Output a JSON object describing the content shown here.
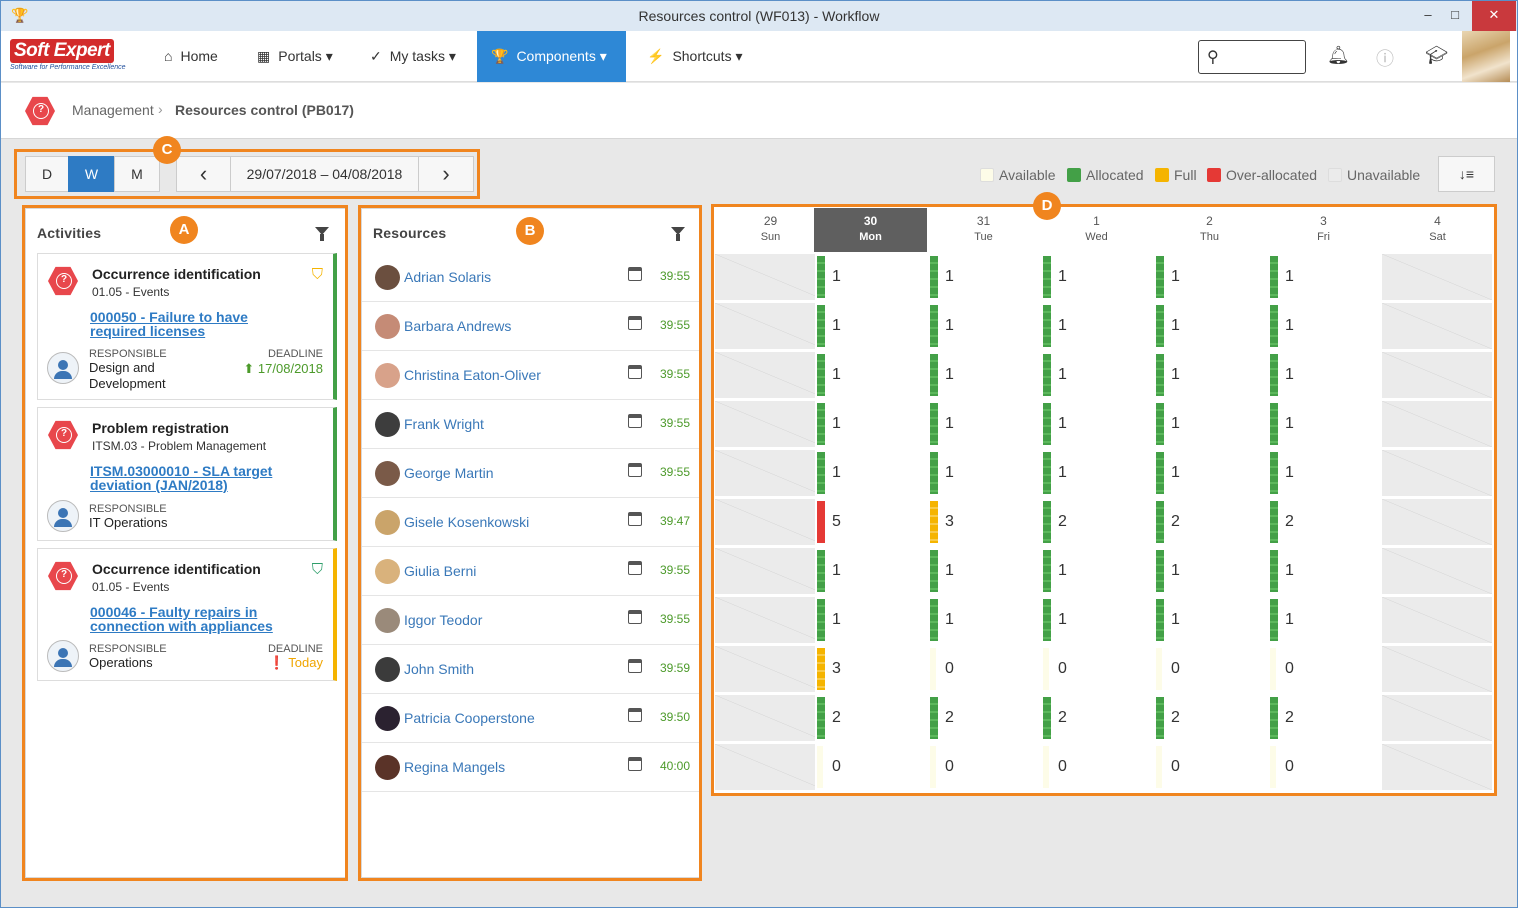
{
  "window": {
    "title": "Resources control (WF013) - Workflow",
    "controls": {
      "minimize": "–",
      "maximize": "□",
      "close": "✕"
    }
  },
  "nav": {
    "logo": {
      "text": "Soft Expert",
      "tagline": "Software for Performance Excellence"
    },
    "items": [
      {
        "label": "Home",
        "icon": "home-icon",
        "glyph": "⌂"
      },
      {
        "label": "Portals",
        "icon": "grid-icon",
        "glyph": "▦"
      },
      {
        "label": "My tasks",
        "icon": "check-icon",
        "glyph": "✓"
      },
      {
        "label": "Components",
        "icon": "trophy-icon",
        "glyph": "🏆"
      },
      {
        "label": "Shortcuts",
        "icon": "bolt-icon",
        "glyph": "⚡"
      }
    ],
    "dropdown_caret": "▾",
    "active_item": "Components",
    "search_placeholder": "",
    "icons": [
      "search-icon",
      "bell-icon",
      "help-icon",
      "graduation-cap-icon"
    ]
  },
  "breadcrumb": {
    "parent": "Management",
    "separator": "›",
    "current": "Resources control (PB017)"
  },
  "toolbar": {
    "views": [
      "D",
      "W",
      "M"
    ],
    "active_view": "W",
    "prev": "‹",
    "next": "›",
    "range": "29/07/2018 – 04/08/2018"
  },
  "legend": [
    {
      "label": "Available",
      "color": "#fdfce8"
    },
    {
      "label": "Allocated",
      "color": "#43a047"
    },
    {
      "label": "Full",
      "color": "#f5b400"
    },
    {
      "label": "Over-allocated",
      "color": "#e53935"
    },
    {
      "label": "Unavailable",
      "color": "#ebebeb"
    }
  ],
  "sort_button": "↓≡",
  "annotations": {
    "a": "A",
    "b": "B",
    "c": "C",
    "d": "D"
  },
  "activities": {
    "header": "Activities",
    "cards": [
      {
        "title": "Occurrence identification",
        "subtitle": "01.05 - Events",
        "link_lines": [
          "000050 - Failure to have",
          "required licenses"
        ],
        "responsible_label": "RESPONSIBLE",
        "responsible_lines": [
          "Design and",
          "Development"
        ],
        "deadline_label": "DEADLINE",
        "deadline": "17/08/2018",
        "deadline_glyph": "⬆",
        "deadline_color": "#4c9a2a",
        "shield_glyph": "⛉",
        "shield_color": "#f5b400",
        "accent": "#43a047"
      },
      {
        "title": "Problem registration",
        "subtitle": "ITSM.03 - Problem Management",
        "link_lines": [
          "ITSM.03000010 - SLA target",
          "deviation (JAN/2018)"
        ],
        "responsible_label": "RESPONSIBLE",
        "responsible_lines": [
          "IT Operations"
        ],
        "accent": "#43a047"
      },
      {
        "title": "Occurrence identification",
        "subtitle": "01.05 - Events",
        "link_lines": [
          "000046 - Faulty repairs in",
          "connection with appliances"
        ],
        "responsible_label": "RESPONSIBLE",
        "responsible_lines": [
          "Operations"
        ],
        "deadline_label": "DEADLINE",
        "deadline": "Today",
        "deadline_glyph": "❗",
        "deadline_color": "#f0a500",
        "shield_glyph": "⛉",
        "shield_color": "#2e9e6a",
        "accent": "#f5b400"
      }
    ]
  },
  "resources": {
    "header": "Resources",
    "rows": [
      {
        "name": "Adrian Solaris",
        "hours": "39:55",
        "avatar": "#6b4f3f"
      },
      {
        "name": "Barbara Andrews",
        "hours": "39:55",
        "avatar": "#c58b76"
      },
      {
        "name": "Christina Eaton-Oliver",
        "hours": "39:55",
        "avatar": "#d8a28a"
      },
      {
        "name": "Frank Wright",
        "hours": "39:55",
        "avatar": "#3d3d3d"
      },
      {
        "name": "George Martin",
        "hours": "39:55",
        "avatar": "#7a5a48"
      },
      {
        "name": "Gisele Kosenkowski",
        "hours": "39:47",
        "avatar": "#caa46a"
      },
      {
        "name": "Giulia Berni",
        "hours": "39:55",
        "avatar": "#d9b27c"
      },
      {
        "name": "Iggor Teodor",
        "hours": "39:55",
        "avatar": "#9a8a7a"
      },
      {
        "name": "John Smith",
        "hours": "39:59",
        "avatar": "#3b3b3b"
      },
      {
        "name": "Patricia Cooperstone",
        "hours": "39:50",
        "avatar": "#2b2230"
      },
      {
        "name": "Regina Mangels",
        "hours": "40:00",
        "avatar": "#5a3328"
      }
    ]
  },
  "calendar": {
    "days": [
      {
        "num": "29",
        "dow": "Sun"
      },
      {
        "num": "30",
        "dow": "Mon",
        "selected": true
      },
      {
        "num": "31",
        "dow": "Tue"
      },
      {
        "num": "1",
        "dow": "Wed"
      },
      {
        "num": "2",
        "dow": "Thu"
      },
      {
        "num": "3",
        "dow": "Fri"
      },
      {
        "num": "4",
        "dow": "Sat"
      }
    ],
    "rows": [
      [
        null,
        [
          "1",
          "alloc"
        ],
        [
          "1",
          "alloc"
        ],
        [
          "1",
          "alloc"
        ],
        [
          "1",
          "alloc"
        ],
        [
          "1",
          "alloc"
        ],
        null
      ],
      [
        null,
        [
          "1",
          "alloc"
        ],
        [
          "1",
          "alloc"
        ],
        [
          "1",
          "alloc"
        ],
        [
          "1",
          "alloc"
        ],
        [
          "1",
          "alloc"
        ],
        null
      ],
      [
        null,
        [
          "1",
          "alloc"
        ],
        [
          "1",
          "alloc"
        ],
        [
          "1",
          "alloc"
        ],
        [
          "1",
          "alloc"
        ],
        [
          "1",
          "alloc"
        ],
        null
      ],
      [
        null,
        [
          "1",
          "alloc"
        ],
        [
          "1",
          "alloc"
        ],
        [
          "1",
          "alloc"
        ],
        [
          "1",
          "alloc"
        ],
        [
          "1",
          "alloc"
        ],
        null
      ],
      [
        null,
        [
          "1",
          "alloc"
        ],
        [
          "1",
          "alloc"
        ],
        [
          "1",
          "alloc"
        ],
        [
          "1",
          "alloc"
        ],
        [
          "1",
          "alloc"
        ],
        null
      ],
      [
        null,
        [
          "5",
          "over"
        ],
        [
          "3",
          "full"
        ],
        [
          "2",
          "alloc"
        ],
        [
          "2",
          "alloc"
        ],
        [
          "2",
          "alloc"
        ],
        null
      ],
      [
        null,
        [
          "1",
          "alloc"
        ],
        [
          "1",
          "alloc"
        ],
        [
          "1",
          "alloc"
        ],
        [
          "1",
          "alloc"
        ],
        [
          "1",
          "alloc"
        ],
        null
      ],
      [
        null,
        [
          "1",
          "alloc"
        ],
        [
          "1",
          "alloc"
        ],
        [
          "1",
          "alloc"
        ],
        [
          "1",
          "alloc"
        ],
        [
          "1",
          "alloc"
        ],
        null
      ],
      [
        null,
        [
          "3",
          "full"
        ],
        [
          "0",
          "avail"
        ],
        [
          "0",
          "avail"
        ],
        [
          "0",
          "avail"
        ],
        [
          "0",
          "avail"
        ],
        null
      ],
      [
        null,
        [
          "2",
          "alloc"
        ],
        [
          "2",
          "alloc"
        ],
        [
          "2",
          "alloc"
        ],
        [
          "2",
          "alloc"
        ],
        [
          "2",
          "alloc"
        ],
        null
      ],
      [
        null,
        [
          "0",
          "avail"
        ],
        [
          "0",
          "avail"
        ],
        [
          "0",
          "avail"
        ],
        [
          "0",
          "avail"
        ],
        [
          "0",
          "avail"
        ],
        null
      ]
    ]
  }
}
